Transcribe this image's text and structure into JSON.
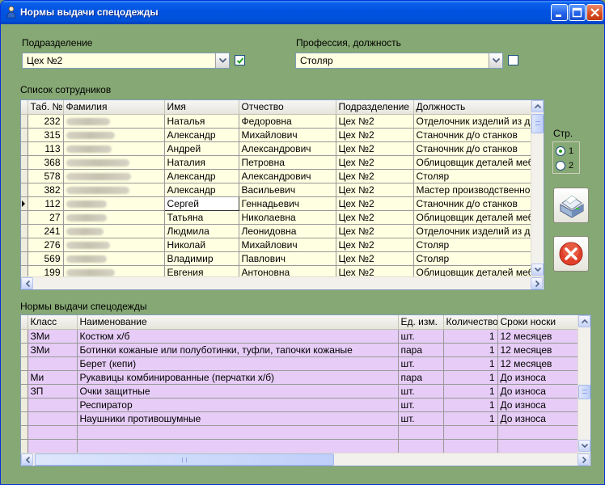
{
  "window": {
    "title": "Нормы выдачи спецодежды"
  },
  "filters": {
    "department_label": "Подразделение",
    "department_value": "Цех №2",
    "department_checked": true,
    "profession_label": "Профессия, должность",
    "profession_value": "Столяр",
    "profession_checked": false
  },
  "employees": {
    "section_title": "Список сотрудников",
    "columns": [
      "Таб. №",
      "Фамилия",
      "Имя",
      "Отчество",
      "Подразделение",
      "Должность"
    ],
    "selected_index": 6,
    "rows": [
      {
        "tab": "232",
        "first": "Наталья",
        "middle": "Федоровна",
        "dept": "Цех №2",
        "pos": "Отделочник изделий из д"
      },
      {
        "tab": "315",
        "first": "Александр",
        "middle": "Михайлович",
        "dept": "Цех №2",
        "pos": "Станочник д/о станков"
      },
      {
        "tab": "113",
        "first": "Андрей",
        "middle": "Александрович",
        "dept": "Цех №2",
        "pos": "Станочник д/о станков"
      },
      {
        "tab": "368",
        "first": "Наталия",
        "middle": "Петровна",
        "dept": "Цех №2",
        "pos": "Облицовщик деталей меб"
      },
      {
        "tab": "578",
        "first": "Александр",
        "middle": "Александрович",
        "dept": "Цех №2",
        "pos": "Столяр"
      },
      {
        "tab": "382",
        "first": "Александр",
        "middle": "Васильевич",
        "dept": "Цех №2",
        "pos": "Мастер производственно"
      },
      {
        "tab": "112",
        "first": "Сергей",
        "middle": "Геннадьевич",
        "dept": "Цех №2",
        "pos": "Станочник д/о станков"
      },
      {
        "tab": "27",
        "first": "Татьяна",
        "middle": "Николаевна",
        "dept": "Цех №2",
        "pos": "Облицовщик деталей меб"
      },
      {
        "tab": "241",
        "first": "Людмила",
        "middle": "Леонидовна",
        "dept": "Цех №2",
        "pos": "Отделочник изделий из д"
      },
      {
        "tab": "276",
        "first": "Николай",
        "middle": "Михайлович",
        "dept": "Цех №2",
        "pos": "Столяр"
      },
      {
        "tab": "569",
        "first": "Владимир",
        "middle": "Павлович",
        "dept": "Цех №2",
        "pos": "Столяр"
      },
      {
        "tab": "199",
        "first": "Евгения",
        "middle": "Антоновна",
        "dept": "Цех №2",
        "pos": "Облицовщик деталей меб"
      }
    ]
  },
  "pages": {
    "label": "Стр.",
    "options": [
      "1",
      "2"
    ],
    "selected": "1"
  },
  "actions": {
    "print_icon": "printer-icon",
    "close_icon": "red-x-icon"
  },
  "norms": {
    "section_title": "Нормы выдачи спецодежды",
    "columns": [
      "Класс",
      "Наименование",
      "Ед. изм.",
      "Количество",
      "Сроки носки"
    ],
    "rows": [
      {
        "cls": "ЗМи",
        "name": "Костюм х/б",
        "unit": "шт.",
        "qty": "1",
        "term": "12 месяцев"
      },
      {
        "cls": "ЗМи",
        "name": "Ботинки кожаные или полуботинки, туфли, тапочки кожаные",
        "unit": "пара",
        "qty": "1",
        "term": "12 месяцев"
      },
      {
        "cls": "",
        "name": "Берет (кепи)",
        "unit": "шт.",
        "qty": "1",
        "term": "12 месяцев"
      },
      {
        "cls": "Ми",
        "name": "Рукавицы комбинированные (перчатки х/б)",
        "unit": "пара",
        "qty": "1",
        "term": "До износа"
      },
      {
        "cls": "ЗП",
        "name": "Очки защитные",
        "unit": "шт.",
        "qty": "1",
        "term": "До износа"
      },
      {
        "cls": "",
        "name": "Респиратор",
        "unit": "шт.",
        "qty": "1",
        "term": "До износа"
      },
      {
        "cls": "",
        "name": "Наушники противошумные",
        "unit": "шт.",
        "qty": "1",
        "term": "До износа"
      },
      {
        "cls": "",
        "name": "",
        "unit": "",
        "qty": "",
        "term": ""
      },
      {
        "cls": "",
        "name": "",
        "unit": "",
        "qty": "",
        "term": ""
      },
      {
        "cls": "",
        "name": "",
        "unit": "",
        "qty": "",
        "term": ""
      }
    ]
  },
  "colors": {
    "titlebar": "#0053e1",
    "window_bg": "#86a874",
    "employee_row_bg": "#ffffe1",
    "norm_row_bg": "#e6ccf6"
  }
}
